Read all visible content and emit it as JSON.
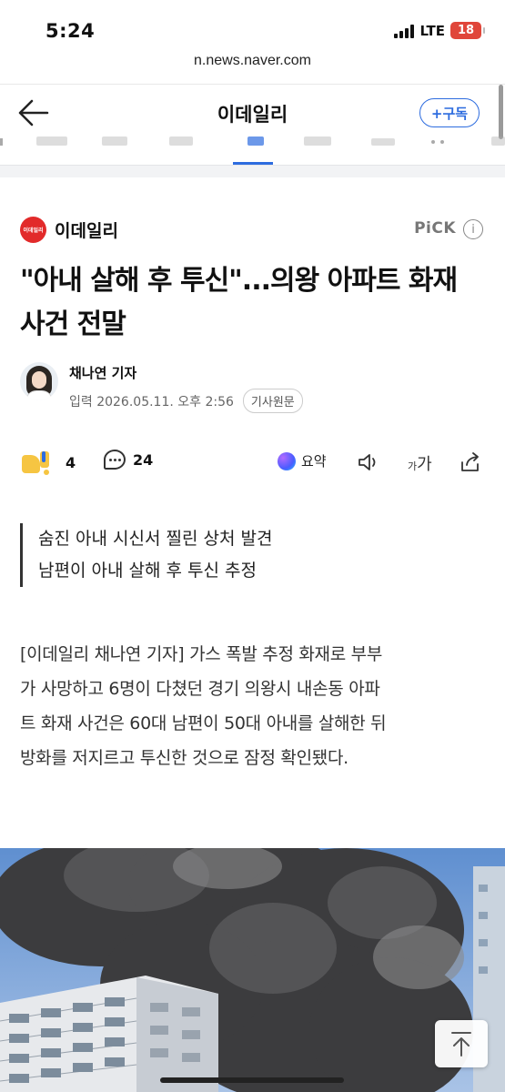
{
  "status_bar": {
    "time": "5:24",
    "network": "LTE",
    "battery": "18"
  },
  "browser": {
    "url": "n.news.naver.com"
  },
  "topnav": {
    "title": "이데일리",
    "subscribe_label": "+구독"
  },
  "article": {
    "press_name": "이데일리",
    "press_logo_text": "이데일리",
    "pick_label": "PiCK",
    "headline": "\"아내 살해 후 투신\"...의왕 아파트 화재 사건 전말",
    "author": "채나연 기자",
    "date": "입력 2026.05.11. 오후 2:56",
    "original_button": "기사원문",
    "reaction_count": "4",
    "comment_count": "24",
    "summary_label": "요약",
    "font_size_label_small": "가",
    "font_size_label_large": "가",
    "subheads": [
      "숨진 아내 시신서 찔린 상처 발견",
      "남편이 아내 살해 후 투신 추정"
    ],
    "body_lines": [
      "[이데일리 채나연 기자] 가스 폭발 추정 화재로 부부",
      "가 사망하고 6명이 다쳤던 경기 의왕시 내손동 아파",
      "트 화재 사건은 60대 남편이 50대 아내를 살해한 뒤",
      "방화를 저지르고 투신한 것으로 잠정 확인됐다."
    ]
  },
  "colors": {
    "accent": "#2d6cdf",
    "press_logo": "#e22a2a",
    "battery": "#e0463a"
  },
  "icons": [
    "back-arrow-icon",
    "info-icon",
    "like-emoji-icon",
    "comment-icon",
    "ai-summary-icon",
    "speaker-icon",
    "font-size-icon",
    "share-icon",
    "scroll-top-icon"
  ]
}
